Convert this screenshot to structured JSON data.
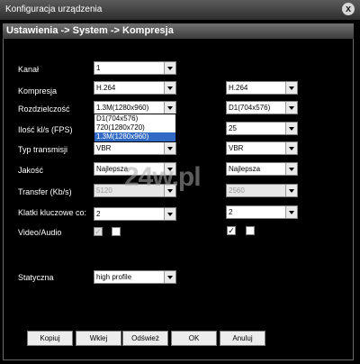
{
  "window": {
    "title": "Konfiguracja urządzenia",
    "close_glyph": "x"
  },
  "breadcrumb": "Ustawienia -> System -> Kompresja",
  "labels": {
    "kanal": "Kanał",
    "kompresja": "Kompresja",
    "rozdzielczosc": "Rozdzielczość",
    "fps": "Ilość kl/s (FPS)",
    "typ_transmisji": "Typ transmisji",
    "jakosc": "Jakość",
    "transfer": "Transfer (Kb/s)",
    "klatki": "Klatki kluczowe co:",
    "video_audio": "Video/Audio",
    "statyczna": "Statyczna"
  },
  "main_stream": {
    "kanal": "1",
    "kompresja": "H.264",
    "rozdzielczosc": "1.3M(1280x960)",
    "fps": "",
    "typ_transmisji": "VBR",
    "jakosc": "Najlepsza",
    "transfer": "5120",
    "klatki": "2",
    "video_checked": "✓",
    "audio_checked": ""
  },
  "extra_stream": {
    "kompresja": "H.264",
    "rozdzielczosc": "D1(704x576)",
    "fps": "25",
    "typ_transmisji": "VBR",
    "jakosc": "Najlepsza",
    "transfer": "2560",
    "klatki": "2",
    "video_checked": "✓",
    "audio_checked": ""
  },
  "resolution_dropdown": {
    "options": [
      "D1(704x576)",
      "720(1280x720)",
      "1.3M(1280x960)"
    ],
    "selected_index": 2
  },
  "statyczna": "high profile",
  "watermark": "24w.pl",
  "buttons": {
    "kopiuj": "Kopiuj",
    "wklej": "Wklej",
    "odswiez": "Odśwież",
    "ok": "OK",
    "anuluj": "Anuluj"
  }
}
